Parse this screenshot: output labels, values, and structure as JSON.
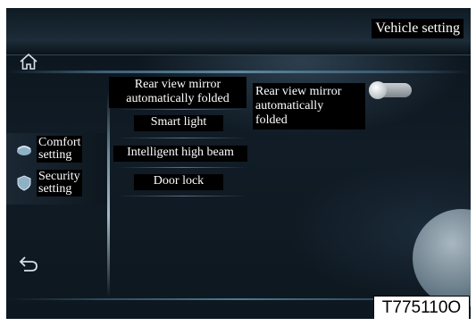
{
  "header": {
    "title": "Vehicle setting"
  },
  "left_nav": {
    "items": [
      {
        "label_line1": "Comfort",
        "label_line2": "setting",
        "icon": "seat-icon"
      },
      {
        "label_line1": "Security",
        "label_line2": "setting",
        "icon": "shield-icon"
      }
    ]
  },
  "menu": {
    "items": [
      {
        "line1": "Rear view mirror",
        "line2": "automatically folded"
      },
      {
        "line1": "Smart light"
      },
      {
        "line1": "Intelligent high beam"
      },
      {
        "line1": "Door lock"
      }
    ]
  },
  "detail": {
    "line1": "Rear view mirror",
    "line2": "automatically",
    "line3": "folded",
    "toggle_on": false
  },
  "nav_icons": {
    "home": "home-icon",
    "back": "back-arrow-icon"
  },
  "figure_code": "T775110O"
}
